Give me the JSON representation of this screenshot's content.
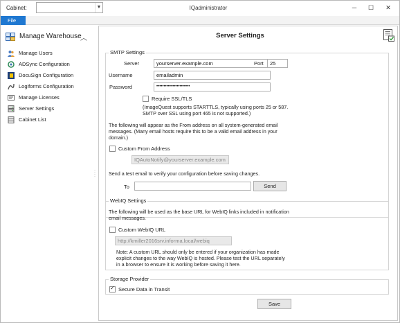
{
  "titlebar": {
    "cabinet_label": "Cabinet:",
    "cabinet_value": "",
    "app_title": "IQadministrator",
    "minimize": "─",
    "maximize": "☐",
    "close": "✕"
  },
  "menu": {
    "file": "File"
  },
  "sidebar": {
    "header": "Manage Warehouse",
    "items": [
      {
        "label": "Manage Users",
        "icon": "users-icon"
      },
      {
        "label": "ADSync Configuration",
        "icon": "adsync-icon"
      },
      {
        "label": "DocuSign Configuration",
        "icon": "docusign-icon"
      },
      {
        "label": "Logiforms Configuration",
        "icon": "logiforms-icon"
      },
      {
        "label": "Manage Licenses",
        "icon": "licenses-icon"
      },
      {
        "label": "Server Settings",
        "icon": "server-icon"
      },
      {
        "label": "Cabinet List",
        "icon": "cabinet-list-icon"
      }
    ]
  },
  "page": {
    "title": "Server Settings"
  },
  "smtp": {
    "title": "SMTP Settings",
    "server_label": "Server",
    "server_value": "yourserver.example.com",
    "port_label": "Port",
    "port_value": "25",
    "username_label": "Username",
    "username_value": "emailadmin",
    "password_label": "Password",
    "password_value": "•••••••••••••••••••••••",
    "ssl_label": "Require SSL/TLS",
    "ssl_checked": false,
    "ssl_note_1": "(ImageQuest supports STARTTLS, typically using ports 25 or 587.",
    "ssl_note_2": "SMTP over SSL using port 465 is not supported.)",
    "from_note_1": "The following will appear as the From address on all system-generated email",
    "from_note_2": "messages. (Many email hosts require this to be a valid email address in your",
    "from_note_3": "domain.)",
    "custom_from_label": "Custom From Address",
    "custom_from_checked": false,
    "custom_from_value": "IQAutoNotify@yourserver.example.com",
    "test_note": "Send a test email to verify your configuration before saving changes.",
    "to_label": "To",
    "to_value": "",
    "send_label": "Send"
  },
  "webiq": {
    "title": "WebIQ Settings",
    "note_1": "The following will be used as the base URL for WebIQ links included in notification",
    "note_2": "email messages.",
    "custom_url_label": "Custom WebIQ URL",
    "custom_url_checked": false,
    "custom_url_value": "http://kmiller2016srv.informa.local/webiq",
    "warn_1": "Note:  A custom URL should only be entered if your organization has made",
    "warn_2": "explicit changes to the way WebIQ is hosted. Please test the URL separately",
    "warn_3": "in a browser to ensure it is working before saving it here."
  },
  "storage": {
    "title": "Storage Provider",
    "secure_label": "Secure Data in Transit",
    "secure_checked": true
  },
  "save_label": "Save",
  "colors": {
    "accent": "#1f78d1"
  }
}
